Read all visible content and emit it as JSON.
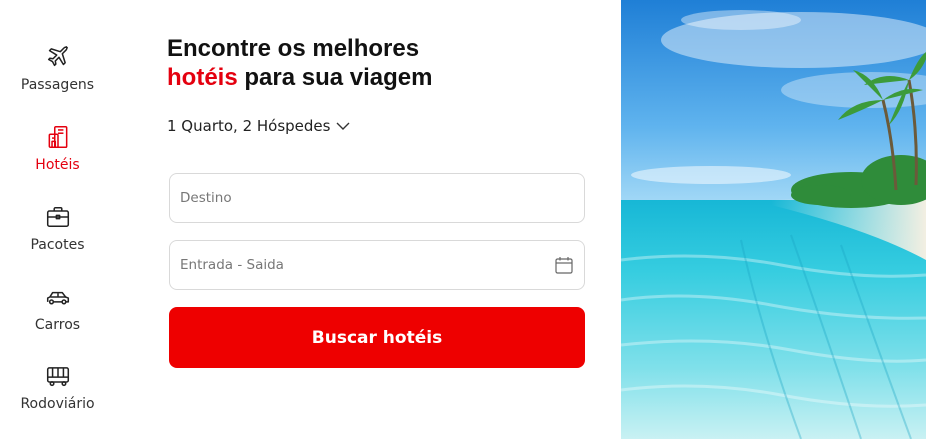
{
  "nav": {
    "items": [
      {
        "label": "Passagens",
        "icon": "airplane-icon",
        "active": false
      },
      {
        "label": "Hotéis",
        "icon": "hotel-icon",
        "active": true
      },
      {
        "label": "Pacotes",
        "icon": "suitcase-icon",
        "active": false
      },
      {
        "label": "Carros",
        "icon": "car-icon",
        "active": false
      },
      {
        "label": "Rodoviário",
        "icon": "bus-icon",
        "active": false
      }
    ]
  },
  "headline": {
    "line1": "Encontre os melhores",
    "accent": "hotéis",
    "rest": " para sua viagem"
  },
  "guests": {
    "label": "1 Quarto, 2 Hóspedes"
  },
  "form": {
    "destination_placeholder": "Destino",
    "dates_placeholder": "Entrada - Saida",
    "search_label": "Buscar hotéis"
  },
  "colors": {
    "accent": "#e4000f",
    "button": "#ee0000"
  }
}
